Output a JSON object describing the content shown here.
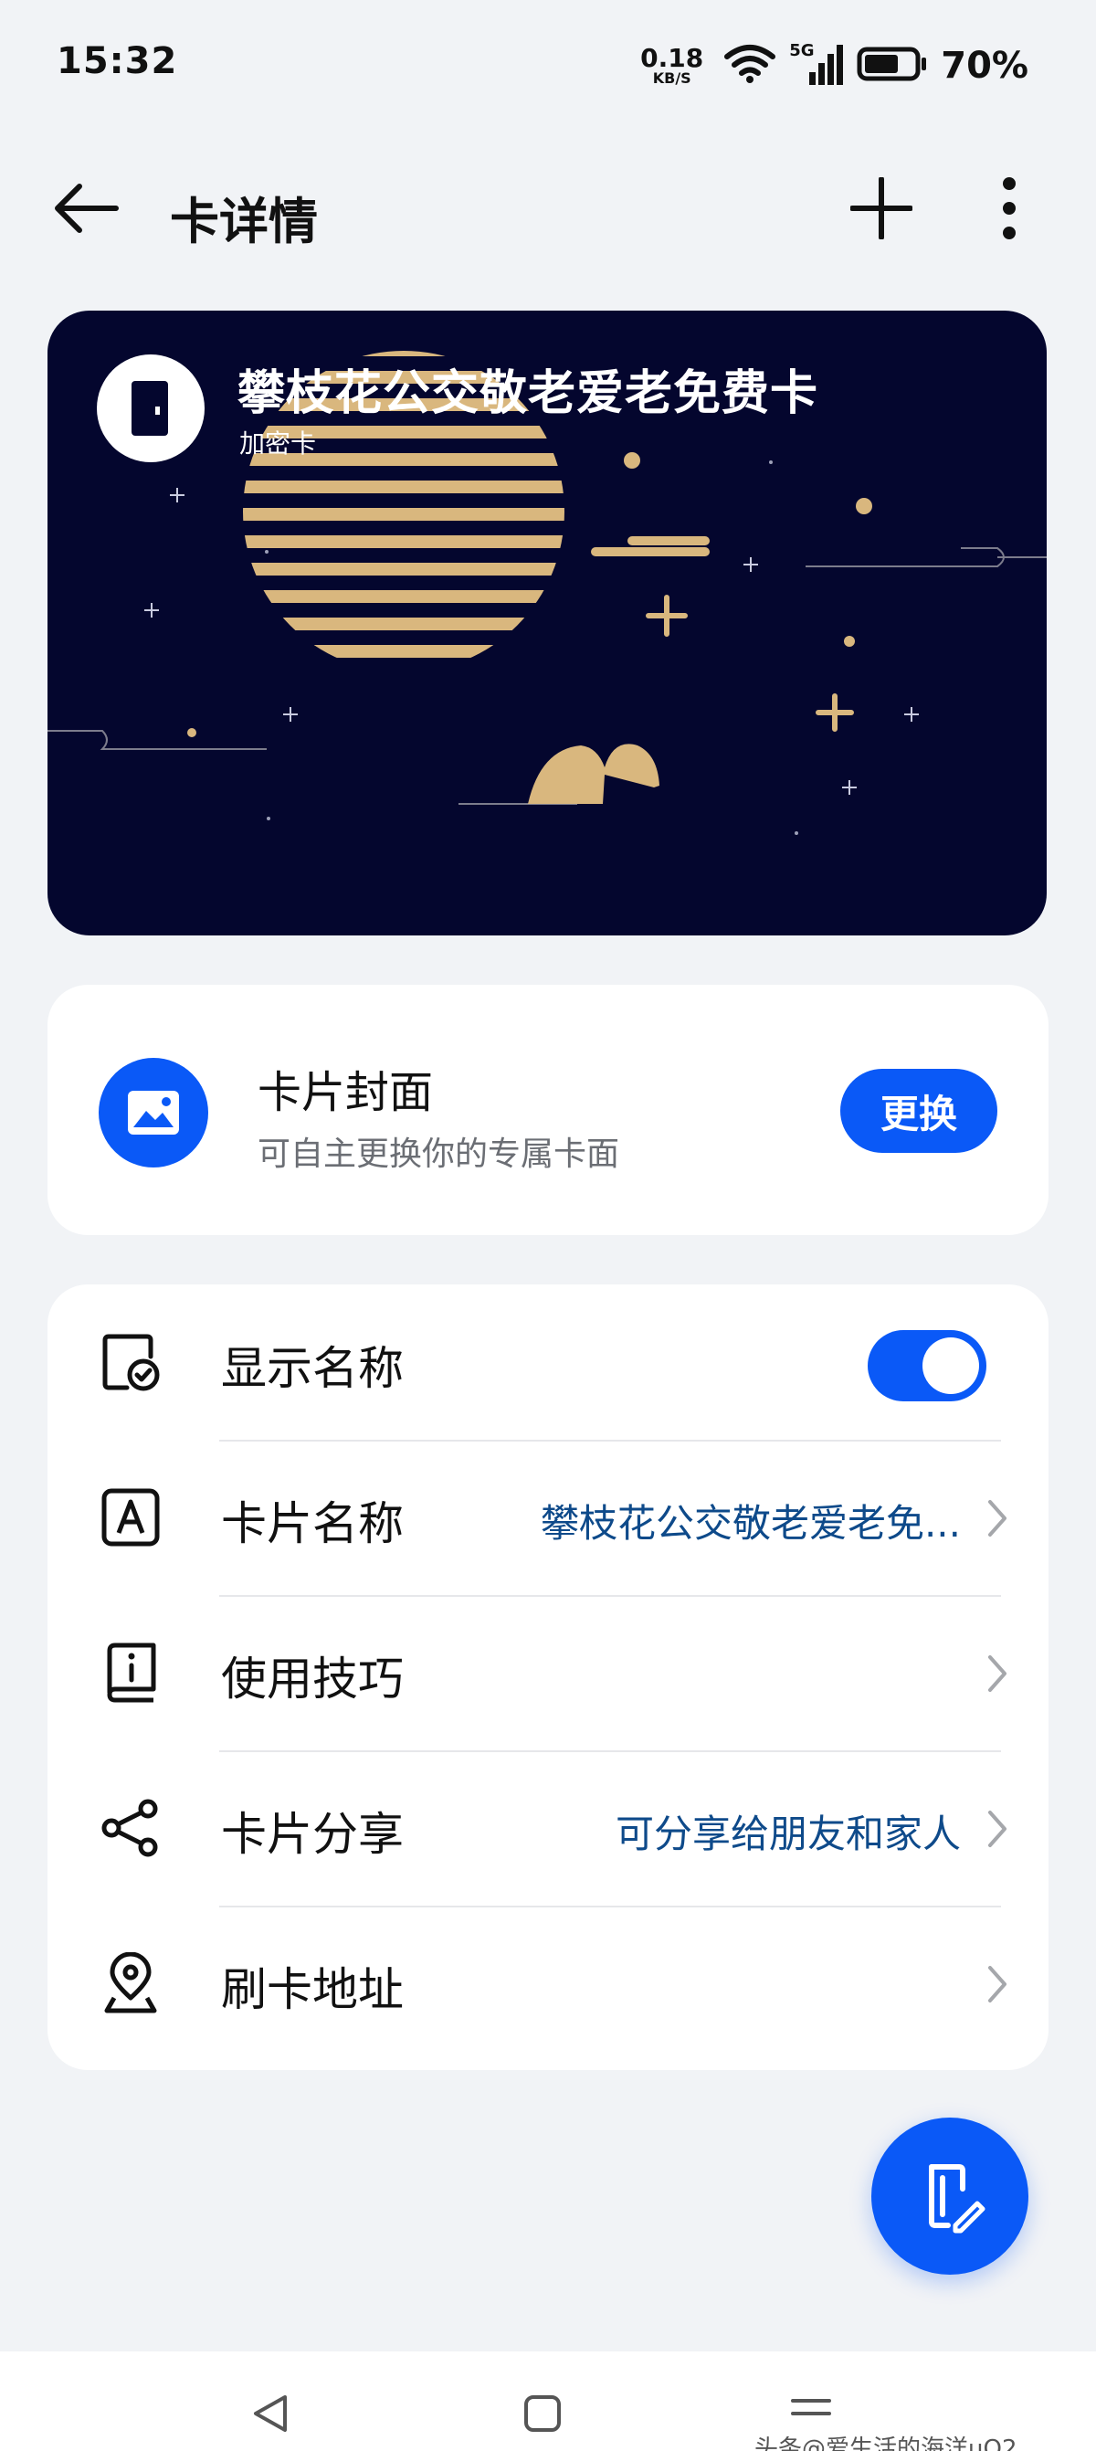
{
  "status_bar": {
    "time": "15:32",
    "net_speed_value": "0.18",
    "net_speed_unit": "KB/S",
    "signal_label": "5G",
    "battery_percent": "70%",
    "battery_level": 0.7,
    "icons": [
      "wifi-icon",
      "signal-icon",
      "battery-icon"
    ]
  },
  "appbar": {
    "title": "卡详情",
    "icons": [
      "back-arrow-icon",
      "plus-icon",
      "more-vertical-icon"
    ]
  },
  "card": {
    "name": "攀枝花公交敬老爱老免费卡",
    "subtitle": "加密卡",
    "background_color": "#04062e",
    "accent_color": "#d9b77e",
    "logo_icon": "door-icon"
  },
  "cover": {
    "title": "卡片封面",
    "description": "可自主更换你的专属卡面",
    "button_label": "更换",
    "icon": "image-icon"
  },
  "settings": {
    "rows": [
      {
        "label": "显示名称",
        "value": "",
        "icon": "display-name-icon",
        "control": "toggle",
        "toggle_on": true
      },
      {
        "label": "卡片名称",
        "value": "攀枝花公交敬老爱老免...",
        "icon": "letter-a-icon",
        "control": "chevron"
      },
      {
        "label": "使用技巧",
        "value": "",
        "icon": "info-book-icon",
        "control": "chevron"
      },
      {
        "label": "卡片分享",
        "value": "可分享给朋友和家人",
        "icon": "share-icon",
        "control": "chevron"
      },
      {
        "label": "刷卡地址",
        "value": "",
        "icon": "location-pin-icon",
        "control": "chevron"
      }
    ]
  },
  "fab": {
    "icon": "card-edit-icon"
  },
  "navbar": {
    "icons": [
      "nav-back-icon",
      "nav-home-icon",
      "nav-recent-icon"
    ],
    "watermark": "头条@爱生活的海洋uO2"
  },
  "colors": {
    "accent": "#0a59f7",
    "link_value": "#0e4a8a",
    "page_background": "#f1f3f6"
  }
}
